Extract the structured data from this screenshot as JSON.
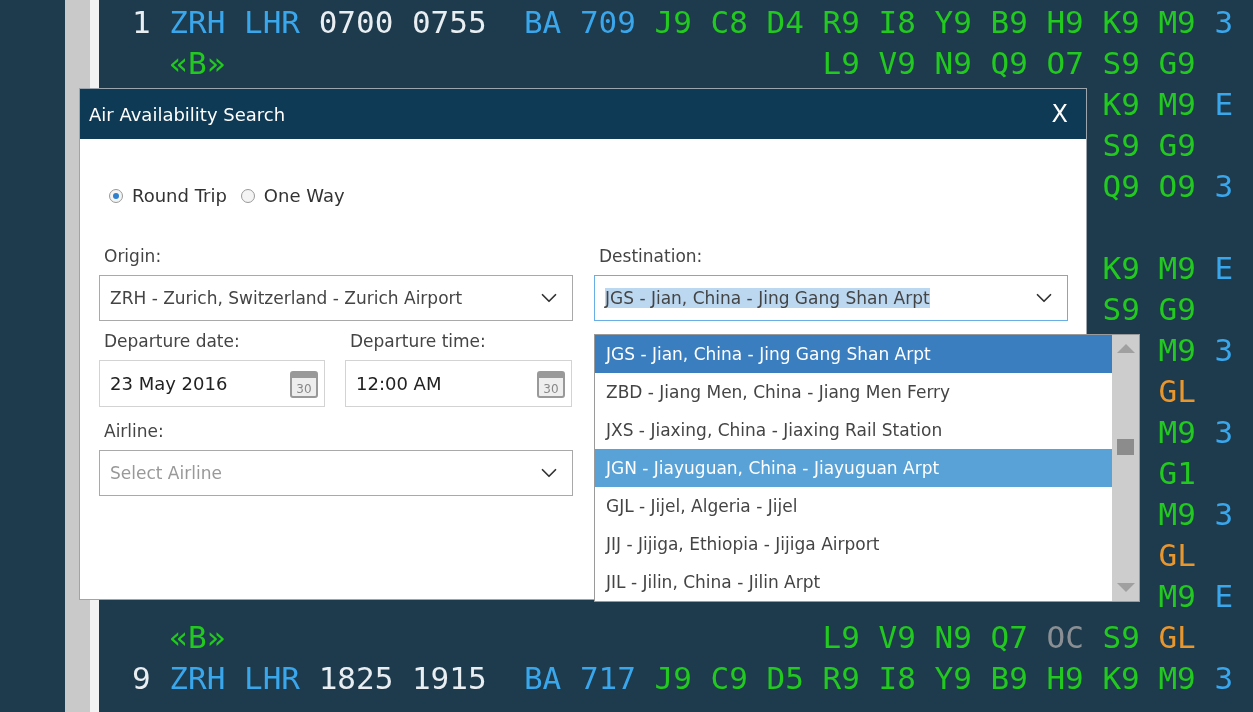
{
  "terminal": {
    "rows": [
      {
        "kind": "flight",
        "line": "1",
        "origin": "ZRH",
        "destination": "LHR",
        "departure": "0700",
        "arrival": "0755",
        "carrier": "BA",
        "flight": "709",
        "classes": [
          {
            "code": "J9",
            "color": "#22c91f"
          },
          {
            "code": "C8",
            "color": "#22c91f"
          },
          {
            "code": "D4",
            "color": "#22c91f"
          },
          {
            "code": "R9",
            "color": "#22c91f"
          },
          {
            "code": "I8",
            "color": "#22c91f"
          },
          {
            "code": "Y9",
            "color": "#22c91f"
          },
          {
            "code": "B9",
            "color": "#22c91f"
          },
          {
            "code": "H9",
            "color": "#22c91f"
          },
          {
            "code": "K9",
            "color": "#22c91f"
          },
          {
            "code": "M9",
            "color": "#22c91f"
          }
        ],
        "extra": "3"
      },
      {
        "kind": "booking",
        "marker": "«B»",
        "classes": [
          {
            "code": "L9",
            "color": "#22c91f"
          },
          {
            "code": "V9",
            "color": "#22c91f"
          },
          {
            "code": "N9",
            "color": "#22c91f"
          },
          {
            "code": "Q9",
            "color": "#22c91f"
          },
          {
            "code": "O7",
            "color": "#22c91f"
          },
          {
            "code": "S9",
            "color": "#22c91f"
          },
          {
            "code": "G9",
            "color": "#22c91f"
          }
        ]
      },
      {
        "kind": "covered-by-dialog",
        "classes": [
          {
            "code": "K9",
            "color": "#22c91f"
          },
          {
            "code": "M9",
            "color": "#22c91f"
          }
        ],
        "extra": "E"
      },
      {
        "kind": "covered-by-dialog",
        "classes": [
          {
            "code": "S9",
            "color": "#22c91f"
          },
          {
            "code": "G9",
            "color": "#22c91f"
          }
        ]
      },
      {
        "kind": "covered-by-dialog",
        "classes": [
          {
            "code": "Q9",
            "color": "#22c91f"
          },
          {
            "code": "O9",
            "color": "#22c91f"
          }
        ],
        "extra": "3"
      },
      {
        "kind": "blank"
      },
      {
        "kind": "covered-by-dialog",
        "classes": [
          {
            "code": "K9",
            "color": "#22c91f"
          },
          {
            "code": "M9",
            "color": "#22c91f"
          }
        ],
        "extra": "E"
      },
      {
        "kind": "covered-by-dialog",
        "classes": [
          {
            "code": "S9",
            "color": "#22c91f"
          },
          {
            "code": "G9",
            "color": "#22c91f"
          }
        ]
      },
      {
        "kind": "covered-by-list",
        "classes": [
          {
            "code": "M9",
            "color": "#22c91f"
          }
        ],
        "extra": "3"
      },
      {
        "kind": "covered-by-list",
        "classes": [
          {
            "code": "GL",
            "color": "#e8962e"
          }
        ]
      },
      {
        "kind": "covered-by-list",
        "classes": [
          {
            "code": "M9",
            "color": "#22c91f"
          }
        ],
        "extra": "3"
      },
      {
        "kind": "covered-by-list",
        "classes": [
          {
            "code": "G1",
            "color": "#22c91f"
          }
        ]
      },
      {
        "kind": "covered-by-list",
        "classes": [
          {
            "code": "M9",
            "color": "#22c91f"
          }
        ],
        "extra": "3"
      },
      {
        "kind": "covered-by-list",
        "classes": [
          {
            "code": "GL",
            "color": "#e8962e"
          }
        ]
      },
      {
        "kind": "covered-by-list",
        "classes": [
          {
            "code": "M9",
            "color": "#22c91f"
          }
        ],
        "extra": "E"
      },
      {
        "kind": "booking",
        "marker": "«B»",
        "classes": [
          {
            "code": "L9",
            "color": "#22c91f"
          },
          {
            "code": "V9",
            "color": "#22c91f"
          },
          {
            "code": "N9",
            "color": "#22c91f"
          },
          {
            "code": "Q7",
            "color": "#22c91f"
          },
          {
            "code": "OC",
            "color": "#8a8f94"
          },
          {
            "code": "S9",
            "color": "#22c91f"
          },
          {
            "code": "GL",
            "color": "#e8962e"
          }
        ]
      },
      {
        "kind": "flight",
        "line": "9",
        "origin": "ZRH",
        "destination": "LHR",
        "departure": "1825",
        "arrival": "1915",
        "carrier": "BA",
        "flight": "717",
        "classes": [
          {
            "code": "J9",
            "color": "#22c91f"
          },
          {
            "code": "C9",
            "color": "#22c91f"
          },
          {
            "code": "D5",
            "color": "#22c91f"
          },
          {
            "code": "R9",
            "color": "#22c91f"
          },
          {
            "code": "I8",
            "color": "#22c91f"
          },
          {
            "code": "Y9",
            "color": "#22c91f"
          },
          {
            "code": "B9",
            "color": "#22c91f"
          },
          {
            "code": "H9",
            "color": "#22c91f"
          },
          {
            "code": "K9",
            "color": "#22c91f"
          },
          {
            "code": "M9",
            "color": "#22c91f"
          }
        ],
        "extra": "3"
      }
    ]
  },
  "dialog": {
    "title": "Air Availability Search",
    "close": "X",
    "trip_types": [
      {
        "label": "Round Trip",
        "selected": true
      },
      {
        "label": "One Way",
        "selected": false
      }
    ],
    "origin": {
      "label": "Origin:",
      "value": "ZRH - Zurich, Switzerland - Zurich Airport"
    },
    "destination": {
      "label": "Destination:",
      "value": "JGS - Jian, China - Jing Gang Shan Arpt",
      "focused": true,
      "options": [
        {
          "label": "JGS - Jian, China - Jing Gang Shan Arpt",
          "selected": true,
          "hovered": false
        },
        {
          "label": "ZBD - Jiang Men, China - Jiang Men Ferry",
          "selected": false,
          "hovered": false
        },
        {
          "label": "JXS - Jiaxing, China - Jiaxing Rail Station",
          "selected": false,
          "hovered": false
        },
        {
          "label": "JGN - Jiayuguan, China - Jiayuguan Arpt",
          "selected": false,
          "hovered": true
        },
        {
          "label": "GJL - Jijel, Algeria - Jijel",
          "selected": false,
          "hovered": false
        },
        {
          "label": "JIJ - Jijiga, Ethiopia - Jijiga Airport",
          "selected": false,
          "hovered": false
        },
        {
          "label": "JIL - Jilin, China - Jilin Arpt",
          "selected": false,
          "hovered": false
        }
      ]
    },
    "departure_date": {
      "label": "Departure date:",
      "value": "23 May 2016",
      "calendar_day": "30"
    },
    "departure_time": {
      "label": "Departure time:",
      "value": "12:00 AM",
      "calendar_day": "30"
    },
    "airline": {
      "label": "Airline:",
      "placeholder": "Select Airline"
    }
  }
}
